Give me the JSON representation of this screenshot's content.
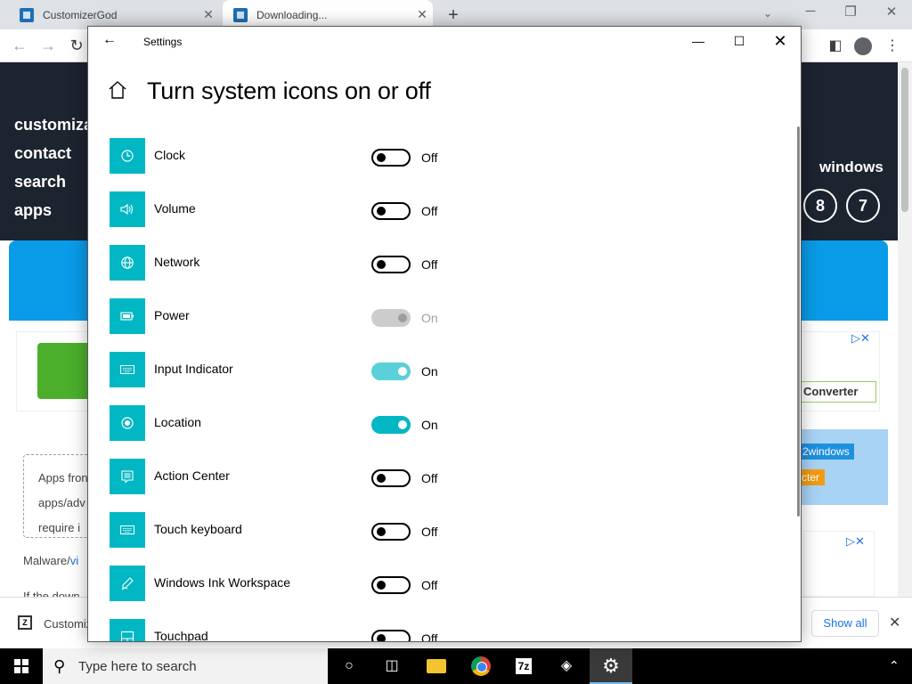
{
  "browser": {
    "tabs": [
      {
        "label": "CustomizerGod",
        "close": "✕"
      },
      {
        "label": "Downloading...",
        "close": "✕"
      }
    ],
    "new_tab": "+",
    "window_controls": {
      "minimize": "─",
      "restore": "❐",
      "close": "✕"
    }
  },
  "webpage": {
    "nav_links": [
      "customizat",
      "contact",
      "search",
      "apps"
    ],
    "windows_label": "windows",
    "version_circles": [
      "8",
      "7"
    ],
    "converter_label": "Converter",
    "tag_2windows": "2windows",
    "tag_orange": "cter",
    "apps_box_lines": [
      "Apps fron",
      "apps/adv",
      "require i"
    ],
    "malware_text": "Malware/",
    "malware_link": "vi",
    "if_the_text": "If the down"
  },
  "download_bar": {
    "item_name": "Customiz",
    "show_all": "Show all",
    "close": "✕"
  },
  "taskbar": {
    "search_placeholder": "Type here to search",
    "seven_zip": "7z"
  },
  "settings_window": {
    "title": "Settings",
    "heading": "Turn system icons on or off",
    "accent_color": "#00b7c3",
    "items": [
      {
        "label": "Clock",
        "state": "Off",
        "icon": "clock-icon"
      },
      {
        "label": "Volume",
        "state": "Off",
        "icon": "volume-icon"
      },
      {
        "label": "Network",
        "state": "Off",
        "icon": "network-icon"
      },
      {
        "label": "Power",
        "state": "On",
        "icon": "power-icon"
      },
      {
        "label": "Input Indicator",
        "state": "On",
        "icon": "keyboard-icon"
      },
      {
        "label": "Location",
        "state": "On",
        "icon": "location-icon"
      },
      {
        "label": "Action Center",
        "state": "Off",
        "icon": "action-center-icon"
      },
      {
        "label": "Touch keyboard",
        "state": "Off",
        "icon": "touch-keyboard-icon"
      },
      {
        "label": "Windows Ink Workspace",
        "state": "Off",
        "icon": "pen-icon"
      },
      {
        "label": "Touchpad",
        "state": "Off",
        "icon": "touchpad-icon"
      }
    ]
  }
}
